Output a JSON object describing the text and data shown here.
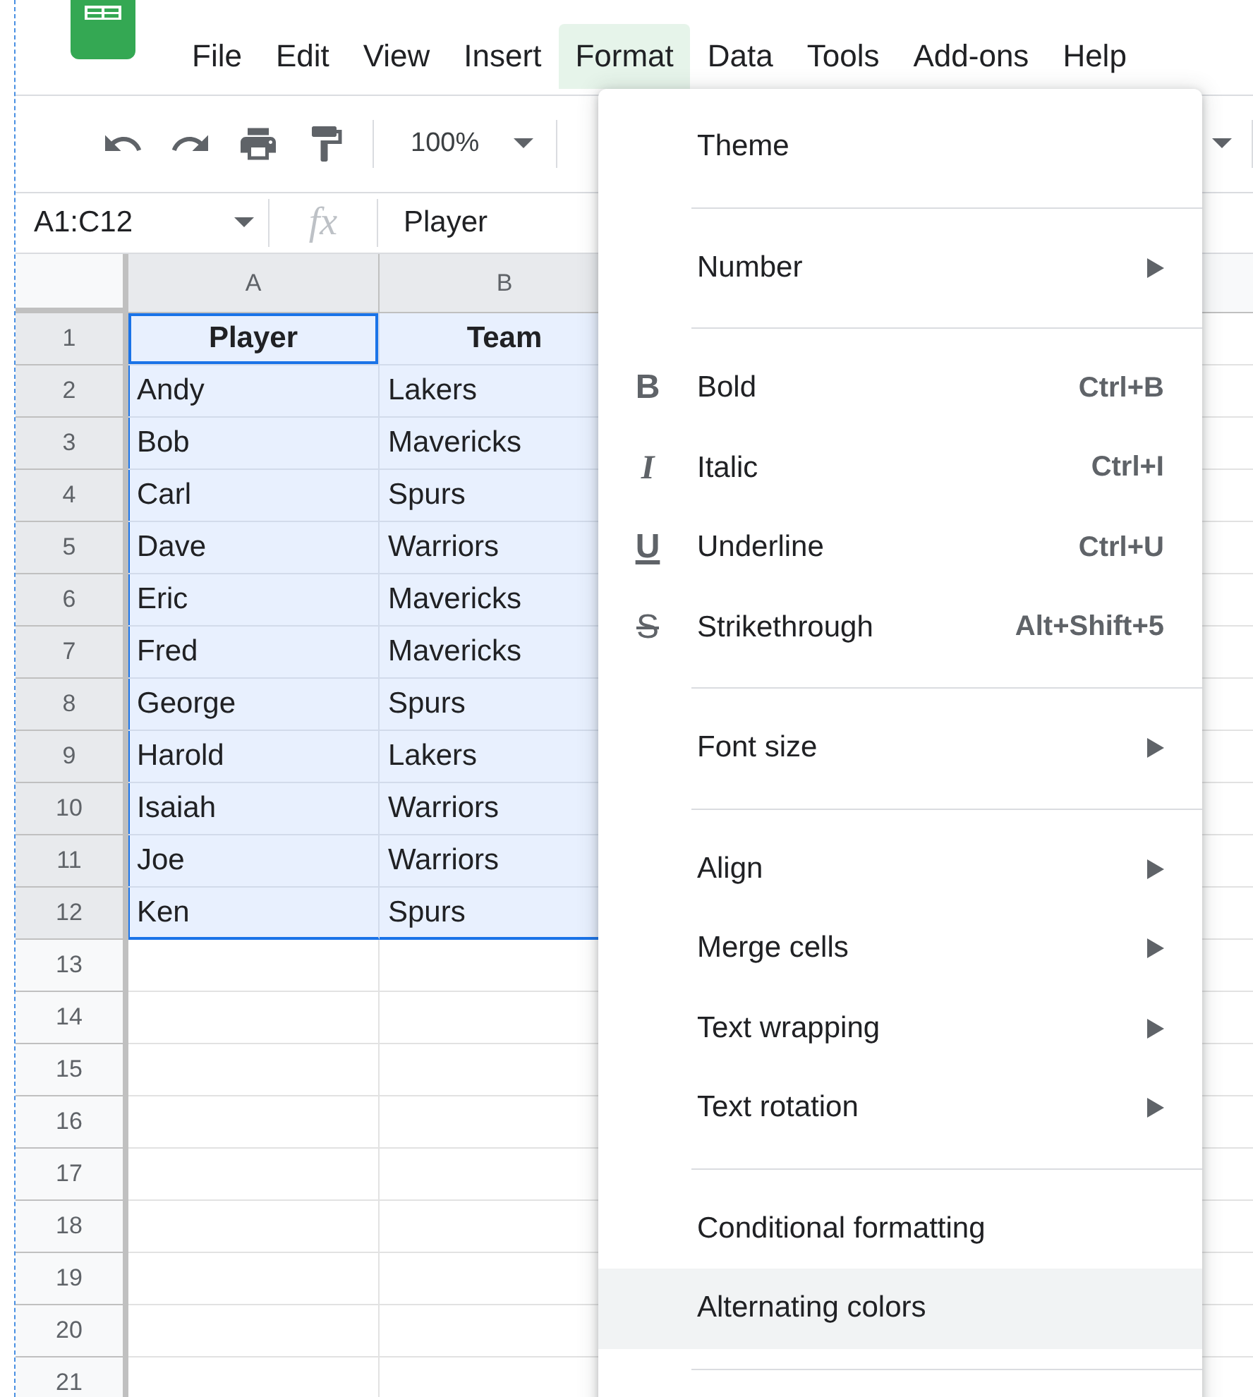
{
  "menubar": [
    {
      "label": "File",
      "selected": false
    },
    {
      "label": "Edit",
      "selected": false
    },
    {
      "label": "View",
      "selected": false
    },
    {
      "label": "Insert",
      "selected": false
    },
    {
      "label": "Format",
      "selected": true
    },
    {
      "label": "Data",
      "selected": false
    },
    {
      "label": "Tools",
      "selected": false
    },
    {
      "label": "Add-ons",
      "selected": false
    },
    {
      "label": "Help",
      "selected": false
    }
  ],
  "toolbar": {
    "zoom": "100%"
  },
  "formula_bar": {
    "name_box": "A1:C12",
    "fx": "fx",
    "value": "Player"
  },
  "sheet": {
    "columns": [
      {
        "label": "A",
        "selected": true
      },
      {
        "label": "B",
        "selected": true
      }
    ],
    "rows": [
      {
        "number": "1",
        "selected": true,
        "cells": [
          {
            "text": "Player",
            "bold": true,
            "active": true
          },
          {
            "text": "Team",
            "bold": true,
            "active": false
          }
        ]
      },
      {
        "number": "2",
        "selected": true,
        "cells": [
          {
            "text": "Andy",
            "bold": false,
            "active": false
          },
          {
            "text": "Lakers",
            "bold": false,
            "active": false
          }
        ]
      },
      {
        "number": "3",
        "selected": true,
        "cells": [
          {
            "text": "Bob",
            "bold": false,
            "active": false
          },
          {
            "text": "Mavericks",
            "bold": false,
            "active": false
          }
        ]
      },
      {
        "number": "4",
        "selected": true,
        "cells": [
          {
            "text": "Carl",
            "bold": false,
            "active": false
          },
          {
            "text": "Spurs",
            "bold": false,
            "active": false
          }
        ]
      },
      {
        "number": "5",
        "selected": true,
        "cells": [
          {
            "text": "Dave",
            "bold": false,
            "active": false
          },
          {
            "text": "Warriors",
            "bold": false,
            "active": false
          }
        ]
      },
      {
        "number": "6",
        "selected": true,
        "cells": [
          {
            "text": "Eric",
            "bold": false,
            "active": false
          },
          {
            "text": "Mavericks",
            "bold": false,
            "active": false
          }
        ]
      },
      {
        "number": "7",
        "selected": true,
        "cells": [
          {
            "text": "Fred",
            "bold": false,
            "active": false
          },
          {
            "text": "Mavericks",
            "bold": false,
            "active": false
          }
        ]
      },
      {
        "number": "8",
        "selected": true,
        "cells": [
          {
            "text": "George",
            "bold": false,
            "active": false
          },
          {
            "text": "Spurs",
            "bold": false,
            "active": false
          }
        ]
      },
      {
        "number": "9",
        "selected": true,
        "cells": [
          {
            "text": "Harold",
            "bold": false,
            "active": false
          },
          {
            "text": "Lakers",
            "bold": false,
            "active": false
          }
        ]
      },
      {
        "number": "10",
        "selected": true,
        "cells": [
          {
            "text": "Isaiah",
            "bold": false,
            "active": false
          },
          {
            "text": "Warriors",
            "bold": false,
            "active": false
          }
        ]
      },
      {
        "number": "11",
        "selected": true,
        "cells": [
          {
            "text": "Joe",
            "bold": false,
            "active": false
          },
          {
            "text": "Warriors",
            "bold": false,
            "active": false
          }
        ]
      },
      {
        "number": "12",
        "selected": true,
        "cells": [
          {
            "text": "Ken",
            "bold": false,
            "active": false
          },
          {
            "text": "Spurs",
            "bold": false,
            "active": false
          }
        ]
      },
      {
        "number": "13",
        "selected": false
      },
      {
        "number": "14",
        "selected": false
      },
      {
        "number": "15",
        "selected": false
      },
      {
        "number": "16",
        "selected": false
      },
      {
        "number": "17",
        "selected": false
      },
      {
        "number": "18",
        "selected": false
      },
      {
        "number": "19",
        "selected": false
      },
      {
        "number": "20",
        "selected": false
      },
      {
        "number": "21",
        "selected": false
      }
    ]
  },
  "format_menu": {
    "items": [
      {
        "kind": "item",
        "label": "Theme",
        "submenu": false,
        "highlighted": false
      },
      {
        "kind": "divider"
      },
      {
        "kind": "item",
        "label": "Number",
        "submenu": true,
        "highlighted": false
      },
      {
        "kind": "divider"
      },
      {
        "kind": "item",
        "label": "Bold",
        "icon": {
          "kind": "bold",
          "glyph": "B"
        },
        "shortcut": "Ctrl+B",
        "submenu": false,
        "highlighted": false
      },
      {
        "kind": "item",
        "label": "Italic",
        "icon": {
          "kind": "italic",
          "glyph": "I"
        },
        "shortcut": "Ctrl+I",
        "submenu": false,
        "highlighted": false
      },
      {
        "kind": "item",
        "label": "Underline",
        "icon": {
          "kind": "underline",
          "glyph": "U"
        },
        "shortcut": "Ctrl+U",
        "submenu": false,
        "highlighted": false
      },
      {
        "kind": "item",
        "label": "Strikethrough",
        "icon": {
          "kind": "strikethrough",
          "glyph": "S"
        },
        "shortcut": "Alt+Shift+5",
        "submenu": false,
        "highlighted": false
      },
      {
        "kind": "divider"
      },
      {
        "kind": "item",
        "label": "Font size",
        "submenu": true,
        "highlighted": false
      },
      {
        "kind": "divider"
      },
      {
        "kind": "item",
        "label": "Align",
        "submenu": true,
        "highlighted": false
      },
      {
        "kind": "item",
        "label": "Merge cells",
        "submenu": true,
        "highlighted": false
      },
      {
        "kind": "item",
        "label": "Text wrapping",
        "submenu": true,
        "highlighted": false
      },
      {
        "kind": "item",
        "label": "Text rotation",
        "submenu": true,
        "highlighted": false
      },
      {
        "kind": "divider"
      },
      {
        "kind": "item",
        "label": "Conditional formatting",
        "submenu": false,
        "highlighted": false
      },
      {
        "kind": "item",
        "label": "Alternating colors",
        "submenu": false,
        "highlighted": true
      },
      {
        "kind": "divider"
      }
    ]
  }
}
